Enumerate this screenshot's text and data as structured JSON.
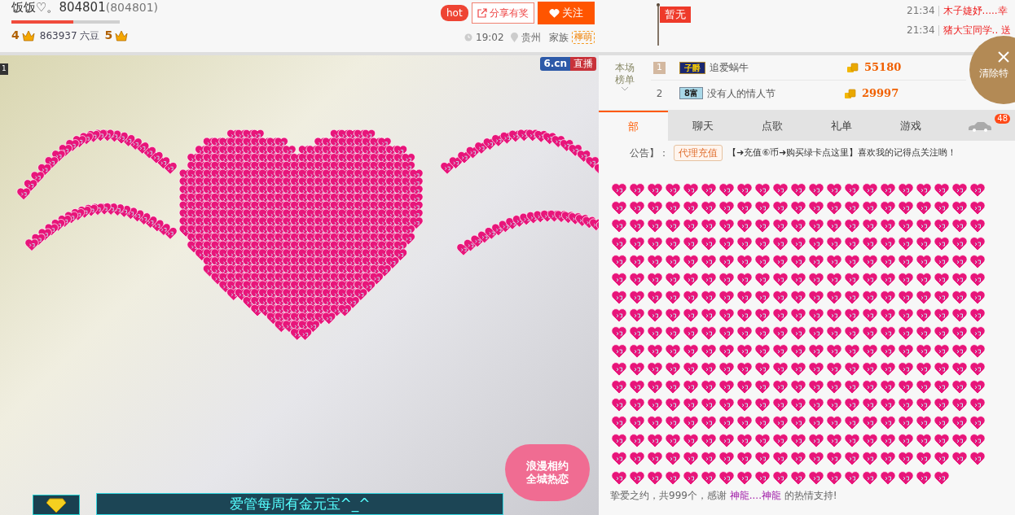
{
  "header": {
    "title": "饭饭♡。804801",
    "room_id": "(804801)",
    "progress": {
      "level": 0.57
    },
    "level_from": "4",
    "beans": "863937 六豆",
    "level_to": "5",
    "hot_badge": "hot",
    "share_button": "分享有奖",
    "follow_button": "关注",
    "time": "19:02",
    "location": "贵州",
    "family_label": "家族",
    "family_tag": "檸萌",
    "flag": "暂无"
  },
  "ticker": [
    {
      "time": "21:34",
      "text": "木子婕妤.....幸"
    },
    {
      "time": "21:34",
      "text": "猪大宝同学.. 送"
    }
  ],
  "clear_effects": "清除特",
  "video": {
    "corner_number": "1",
    "logo": "6.cn",
    "live_badge": "直播",
    "promo_line1": "浪漫相约",
    "promo_line2": "全城热恋",
    "banner": "爱管每周有金元宝^_^"
  },
  "ranking": {
    "title_line1": "本场",
    "title_line2": "榜单",
    "rows": [
      {
        "rank": "1",
        "badge": "子爵",
        "name": "追爱蜗牛",
        "score": "55180"
      },
      {
        "rank": "2",
        "badge": "8富",
        "name": "没有人的情人节",
        "score": "29997"
      }
    ]
  },
  "tabs": [
    {
      "label": "部",
      "selected": true
    },
    {
      "label": "聊天",
      "selected": false
    },
    {
      "label": "点歌",
      "selected": false
    },
    {
      "label": "礼单",
      "selected": false
    },
    {
      "label": "游戏",
      "selected": false
    }
  ],
  "car_count": "48",
  "announcement": {
    "label": "公告】：",
    "tag": "代理充值",
    "text": "【➜充值⑥币➜购买绿卡点这里】喜欢我的记得点关注哟！"
  },
  "gift_message": {
    "prefix": "挚爱之约，共999个，感谢",
    "user": "神龍....神龍",
    "suffix": "的热情支持!"
  }
}
